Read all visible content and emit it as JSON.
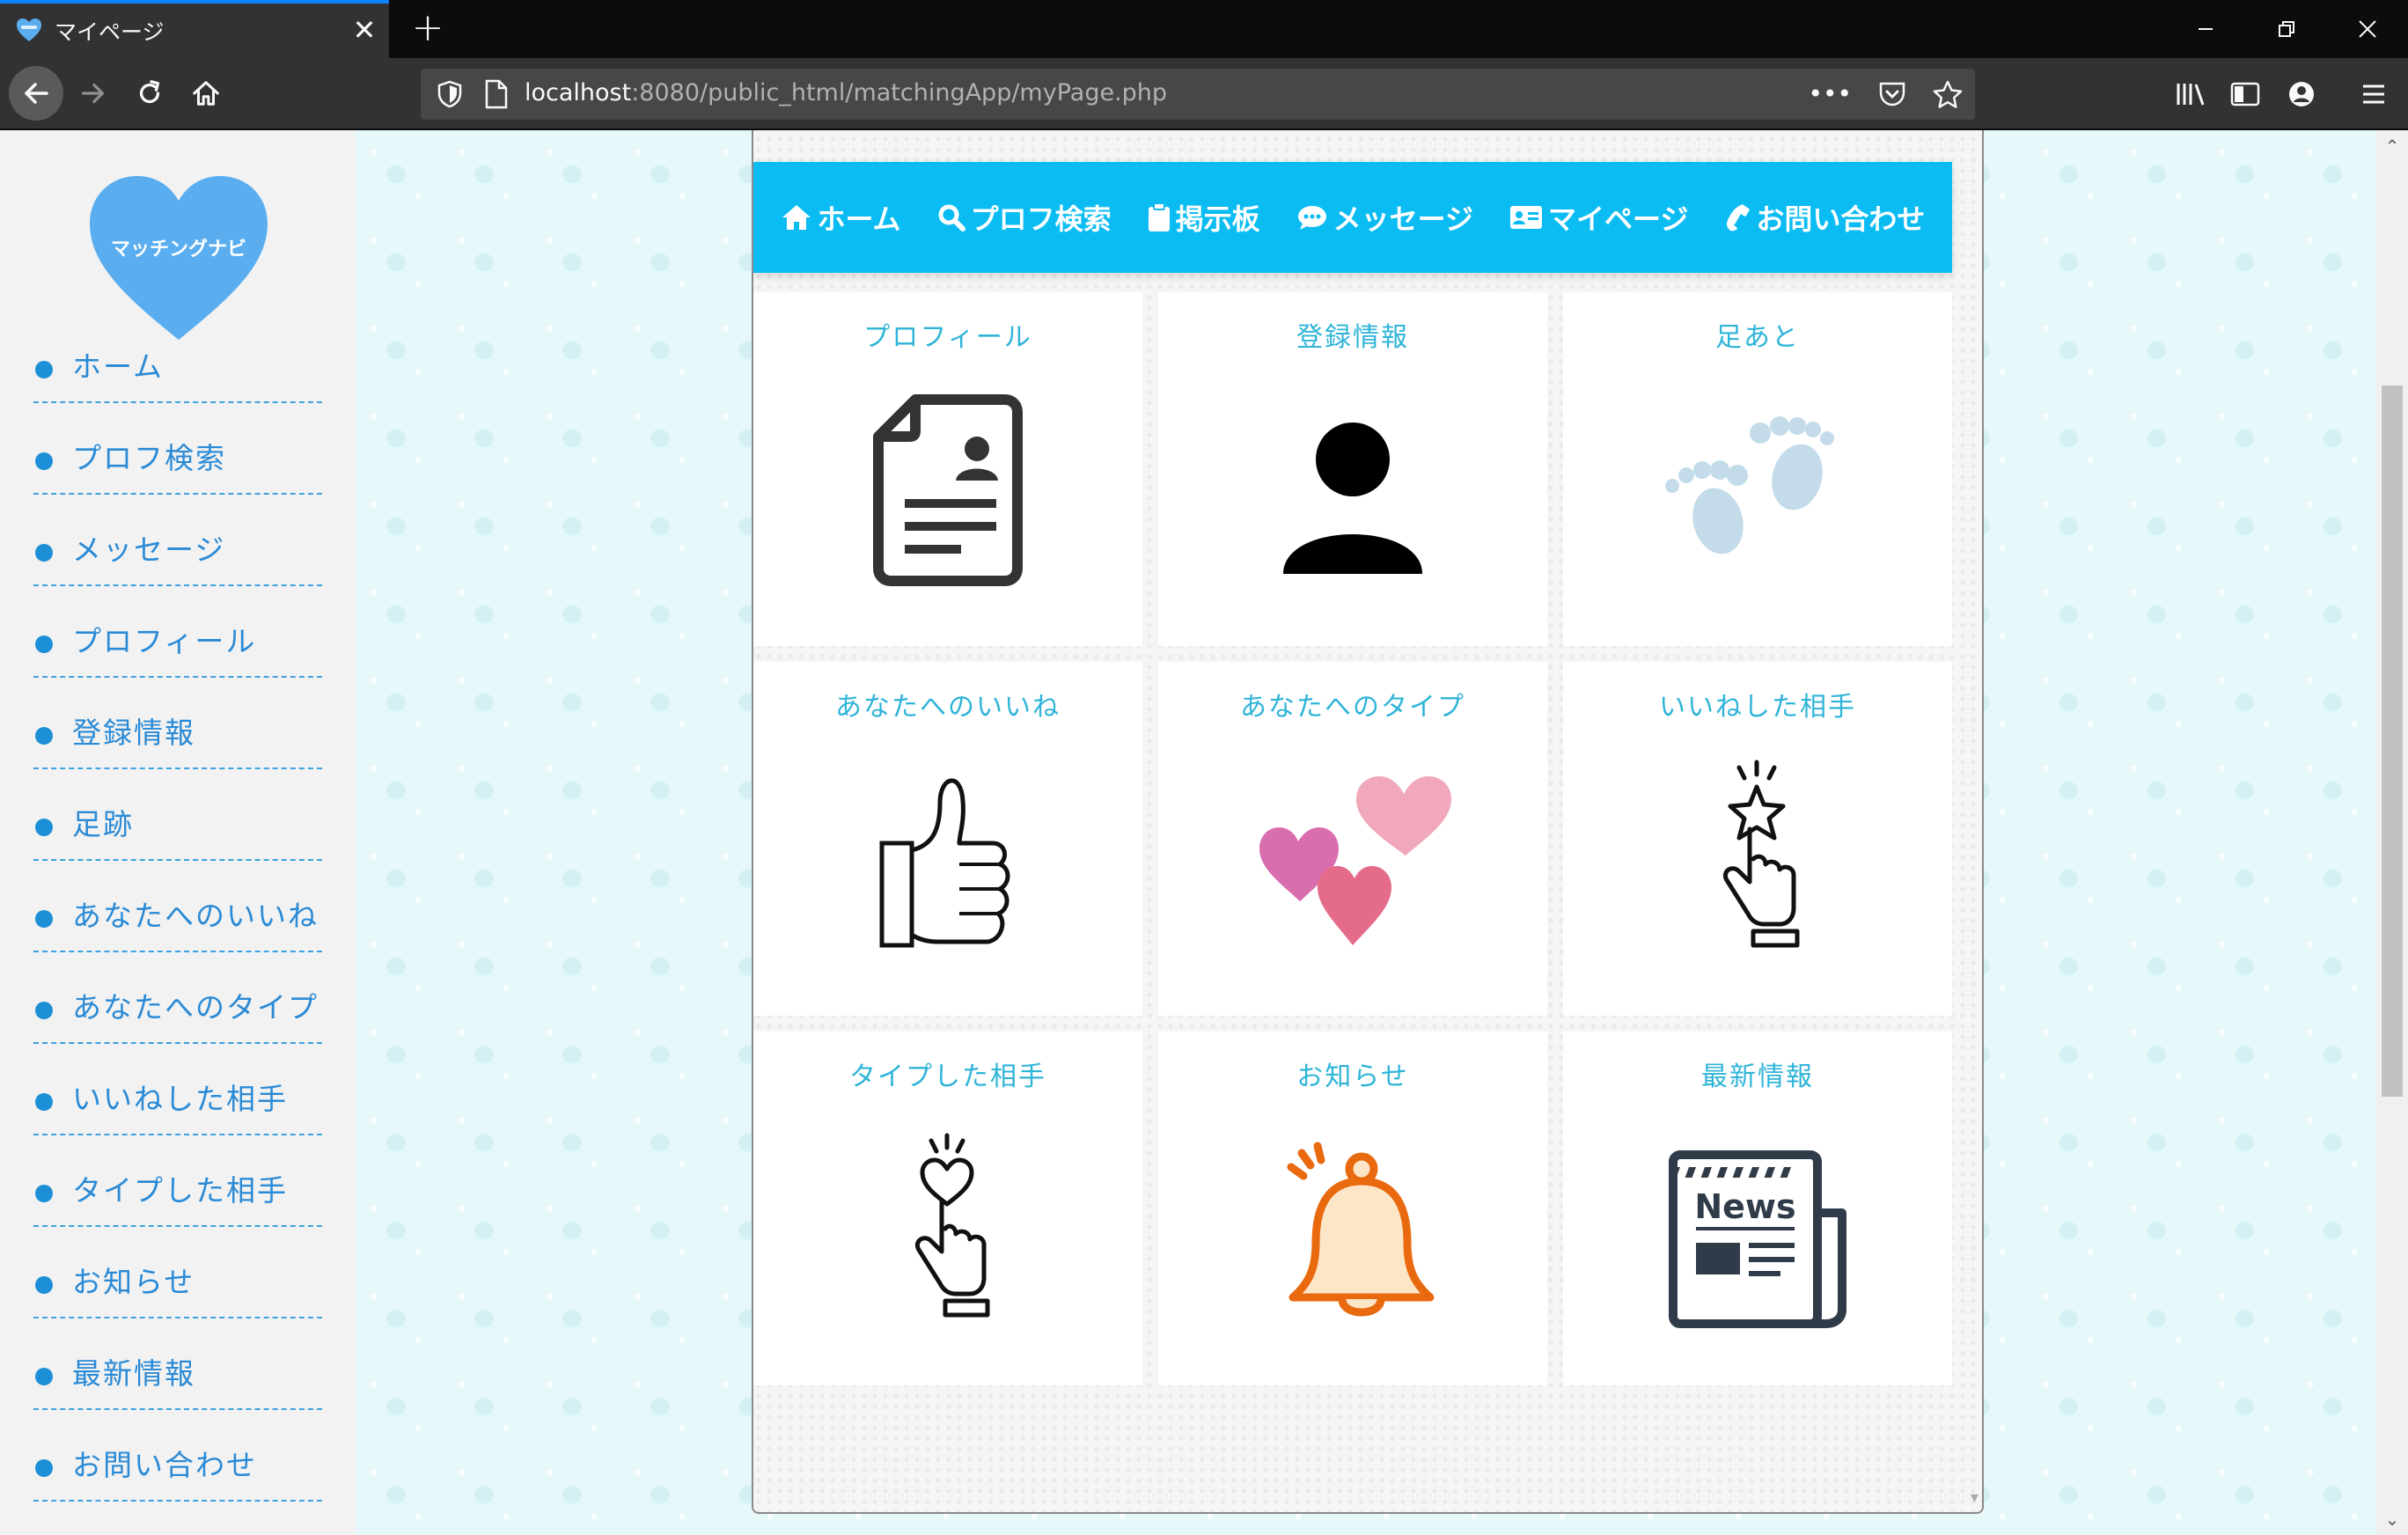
{
  "browser": {
    "tab_title": "マイページ",
    "tab_close": "✕",
    "new_tab": "+",
    "url_host": "localhost",
    "url_rest": ":8080/public_html/matchingApp/myPage.php",
    "url_more": "•••"
  },
  "logo": {
    "text": "マッチングナビ"
  },
  "sidebar": {
    "items": [
      {
        "label": "ホーム"
      },
      {
        "label": "プロフ検索"
      },
      {
        "label": "メッセージ"
      },
      {
        "label": "プロフィール"
      },
      {
        "label": "登録情報"
      },
      {
        "label": "足跡"
      },
      {
        "label": "あなたへのいいね"
      },
      {
        "label": "あなたへのタイプ"
      },
      {
        "label": "いいねした相手"
      },
      {
        "label": "タイプした相手"
      },
      {
        "label": "お知らせ"
      },
      {
        "label": "最新情報"
      },
      {
        "label": "お問い合わせ"
      }
    ]
  },
  "topnav": {
    "items": [
      {
        "label": "ホーム",
        "icon": "home-icon"
      },
      {
        "label": "プロフ検索",
        "icon": "search-icon"
      },
      {
        "label": "掲示板",
        "icon": "clipboard-icon"
      },
      {
        "label": "メッセージ",
        "icon": "chat-icon"
      },
      {
        "label": "マイページ",
        "icon": "id-card-icon"
      },
      {
        "label": "お問い合わせ",
        "icon": "phone-icon"
      }
    ]
  },
  "cards": [
    {
      "title": "プロフィール",
      "icon": "profile-document-icon"
    },
    {
      "title": "登録情報",
      "icon": "person-icon"
    },
    {
      "title": "足あと",
      "icon": "footprints-icon"
    },
    {
      "title": "あなたへのいいね",
      "icon": "thumbs-up-icon"
    },
    {
      "title": "あなたへのタイプ",
      "icon": "hearts-icon"
    },
    {
      "title": "いいねした相手",
      "icon": "finger-star-icon"
    },
    {
      "title": "タイプした相手",
      "icon": "finger-heart-icon"
    },
    {
      "title": "お知らせ",
      "icon": "bell-icon"
    },
    {
      "title": "最新情報",
      "icon": "newspaper-icon",
      "icon_text": "News"
    }
  ],
  "colors": {
    "accent": "#0bbcf3",
    "card_title": "#2fb4d8",
    "sidebar_link": "#2a8ad6",
    "logo_heart": "#5aaef0"
  }
}
